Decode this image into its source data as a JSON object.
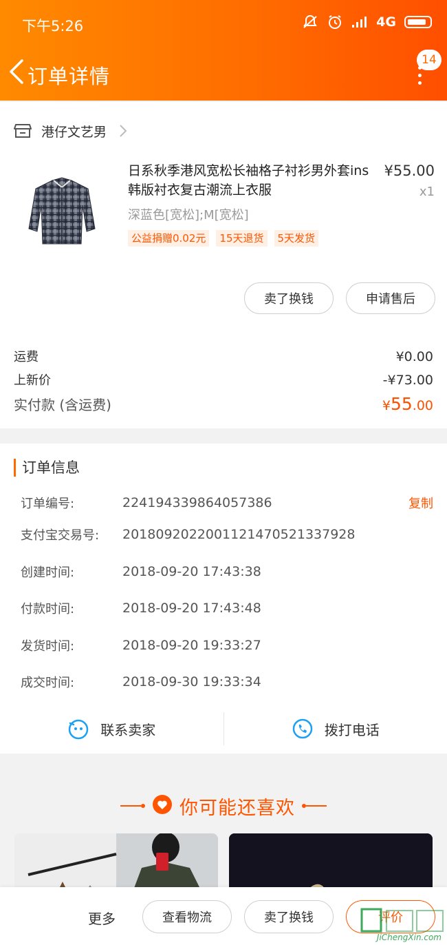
{
  "status_bar": {
    "time": "下午5:26",
    "network": "4G",
    "icons": [
      "mute-icon",
      "alarm-icon",
      "signal-icon",
      "battery-icon"
    ]
  },
  "nav": {
    "title": "订单详情",
    "badge_count": "14"
  },
  "shop": {
    "name": "港仔文艺男"
  },
  "product": {
    "title": "日系秋季港风宽松长袖格子衬衫男外套ins韩版衬衣复古潮流上衣服",
    "price": "¥55.00",
    "quantity": "x1",
    "sku": "深蓝色[宽松];M[宽松]",
    "tags": [
      "公益捐赠0.02元",
      "15天退货",
      "5天发货"
    ]
  },
  "item_actions": {
    "sell": "卖了换钱",
    "after_sale": "申请售后"
  },
  "fees": {
    "shipping_label": "运费",
    "shipping_value": "¥0.00",
    "new_price_label": "上新价",
    "new_price_value": "-¥73.00",
    "paid_label": "实付款 (含运费)",
    "paid_currency": "¥",
    "paid_integer": "55",
    "paid_decimal": ".00"
  },
  "order_info": {
    "title": "订单信息",
    "copy_label": "复制",
    "rows": [
      {
        "label": "订单编号:",
        "value": "224194339864057386"
      },
      {
        "label": "支付宝交易号:",
        "value": "2018092022001121470521337928"
      },
      {
        "label": "创建时间:",
        "value": "2018-09-20 17:43:38"
      },
      {
        "label": "付款时间:",
        "value": "2018-09-20 17:43:48"
      },
      {
        "label": "发货时间:",
        "value": "2018-09-20 19:33:27"
      },
      {
        "label": "成交时间:",
        "value": "2018-09-30 19:33:34"
      }
    ]
  },
  "contact": {
    "seller": "联系卖家",
    "phone": "拨打电话"
  },
  "recommend": {
    "title": "你可能还喜欢"
  },
  "bottom_bar": {
    "more": "更多",
    "logistics": "查看物流",
    "sell": "卖了换钱",
    "review": "评价"
  },
  "watermark": {
    "text": "JiChengXin.com"
  },
  "colors": {
    "brand_orange": "#ff6a00",
    "price_orange": "#ff5000",
    "tag_bg": "#fff0e6"
  }
}
